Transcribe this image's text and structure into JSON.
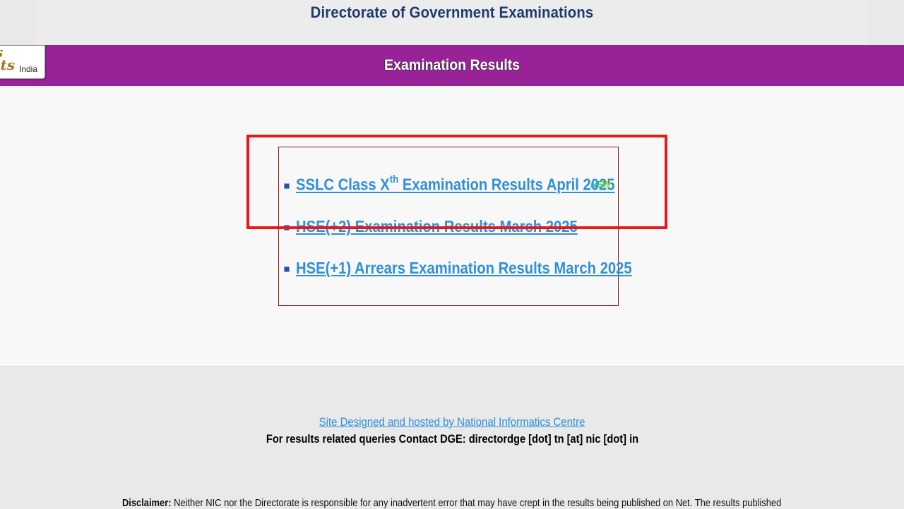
{
  "header": {
    "title": "Directorate of Government Examinations",
    "bar_title": "Examination Results"
  },
  "logo": {
    "script_line1": "s",
    "script_line2": "lts",
    "text": "India"
  },
  "results": {
    "items": [
      {
        "label_pre": "SSLC Class X",
        "label_sup": "th",
        "label_post": " Examination Results April 2025",
        "badge": "NEW"
      },
      {
        "label": "HSE(+2) Examination Results March 2025"
      },
      {
        "label": "HSE(+1) Arrears Examination Results March 2025"
      }
    ]
  },
  "footer": {
    "credit_link": "Site Designed and hosted by National Informatics Centre",
    "contact": "For results related queries Contact DGE:  directordge [dot] tn [at] nic [dot] in",
    "disclaimer_label": "Disclaimer:",
    "disclaimer_text": " Neither NIC nor the Directorate is responsible for any inadvertent error that may have crept in the results being published on Net. The results published"
  },
  "colors": {
    "purple_bar": "#982298",
    "link": "#2f8fd8",
    "highlight": "#e81818",
    "box_border": "#8b1a1a"
  }
}
